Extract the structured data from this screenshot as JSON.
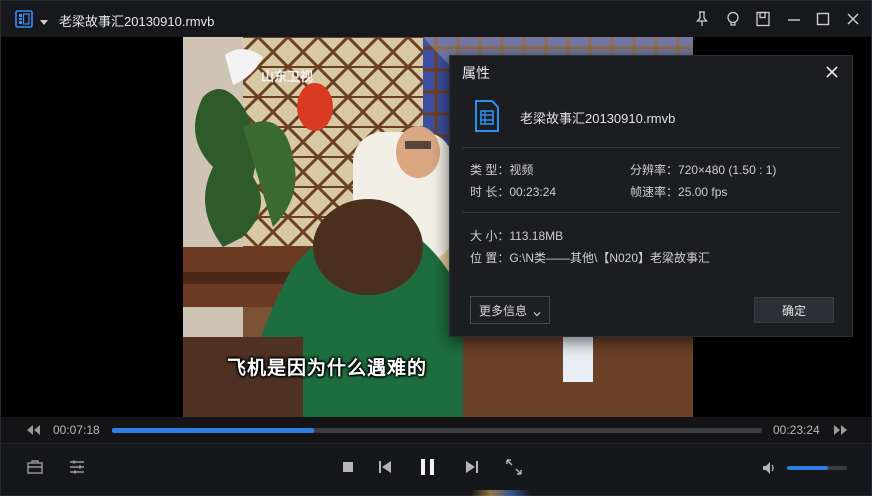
{
  "window": {
    "title": "老梁故事汇20130910.rmvb"
  },
  "player": {
    "subtitle": "飞机是因为什么遇难的",
    "current_time": "00:07:18",
    "total_time": "00:23:24",
    "progress": 0.31,
    "volume": 0.68,
    "accent_color": "#2f7ee3"
  },
  "icons": {
    "app": "playlist-icon",
    "pin": "pin-icon",
    "bulb": "lightbulb-icon",
    "miniplayer": "mini-window-icon",
    "minimize": "minimize-icon",
    "maximize": "maximize-icon",
    "close": "close-icon"
  },
  "dialog": {
    "title": "属性",
    "filename": "老梁故事汇20130910.rmvb",
    "type_label": "类 型：",
    "type_value": "视频",
    "resolution_label": "分辨率：",
    "resolution_value": "720×480 (1.50 : 1)",
    "duration_label": "时 长：",
    "duration_value": "00:23:24",
    "framerate_label": "帧速率：",
    "framerate_value": "25.00 fps",
    "size_label": "大 小：",
    "size_value": "113.18MB",
    "location_label": "位 置：",
    "location_value": "G:\\N类——其他\\【N020】老梁故事汇",
    "more_info": "更多信息",
    "ok": "确定"
  }
}
